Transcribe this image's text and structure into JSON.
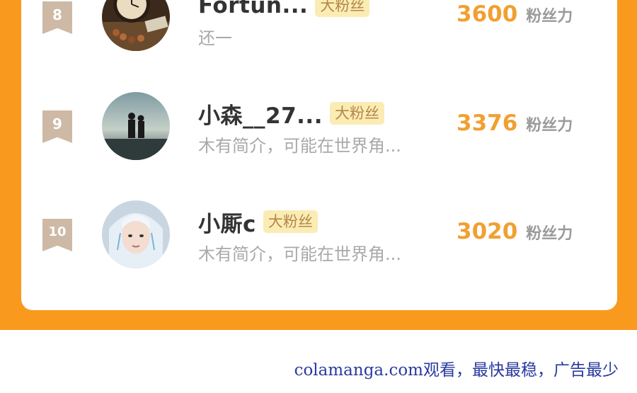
{
  "leaderboard": {
    "entries": [
      {
        "rank": "8",
        "name": "Fortun...",
        "badge": "大粉丝",
        "desc": "还一",
        "score": "3600",
        "unit": "粉丝力",
        "avatar": "clock-photo"
      },
      {
        "rank": "9",
        "name": "小森__27...",
        "badge": "大粉丝",
        "desc": "木有简介，可能在世界角...",
        "score": "3376",
        "unit": "粉丝力",
        "avatar": "couple-silhouette-photo"
      },
      {
        "rank": "10",
        "name": "小厮c",
        "badge": "大粉丝",
        "desc": "木有简介，可能在世界角...",
        "score": "3020",
        "unit": "粉丝力",
        "avatar": "anime-character-photo"
      }
    ]
  },
  "watermark": "colamanga.com观看，最快最稳，广告最少",
  "colors": {
    "accent": "#f99a1e",
    "score": "#f0a031",
    "badge_bg": "#fbecb4",
    "rank_bg": "#cdb9a5"
  }
}
